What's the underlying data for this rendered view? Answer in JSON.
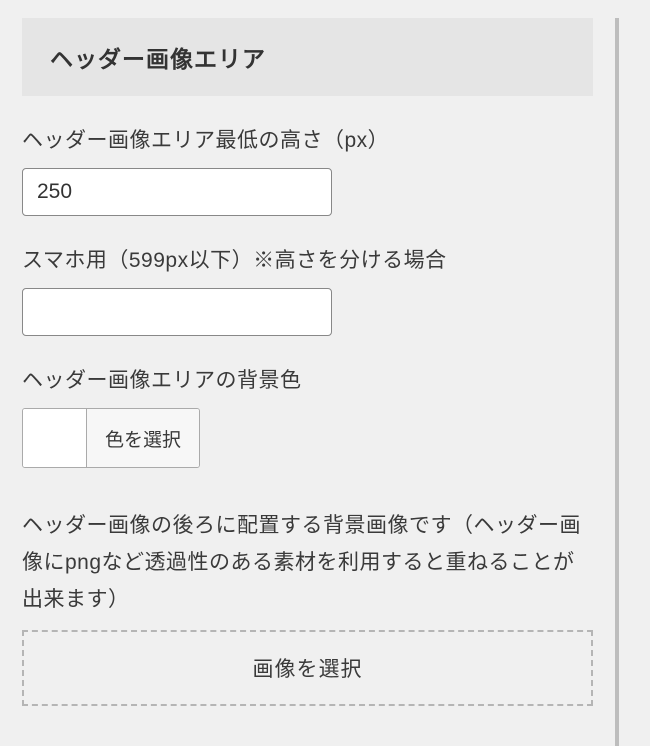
{
  "section": {
    "title": "ヘッダー画像エリア"
  },
  "fields": {
    "min_height": {
      "label": "ヘッダー画像エリア最低の高さ（px）",
      "value": "250"
    },
    "mobile_height": {
      "label": "スマホ用（599px以下）※高さを分ける場合",
      "value": ""
    },
    "bg_color": {
      "label": "ヘッダー画像エリアの背景色",
      "button_label": "色を選択"
    },
    "bg_image": {
      "description": "ヘッダー画像の後ろに配置する背景画像です（ヘッダー画像にpngなど透過性のある素材を利用すると重ねることが出来ます）",
      "button_label": "画像を選択"
    }
  }
}
